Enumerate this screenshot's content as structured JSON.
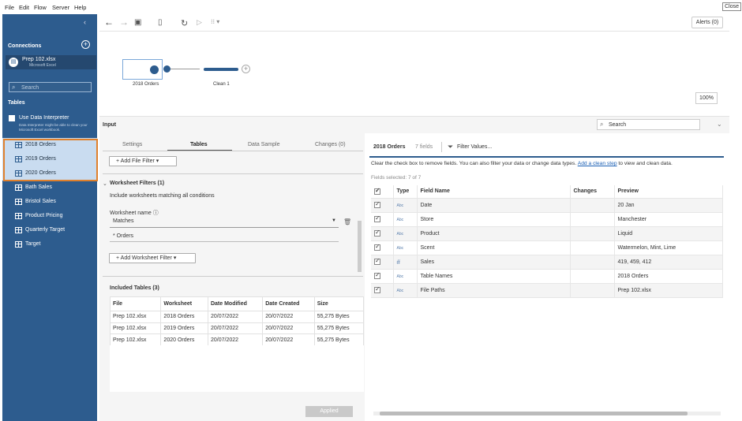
{
  "menu": [
    "File",
    "Edit",
    "Flow",
    "Server",
    "Help"
  ],
  "close_label": "Close",
  "toolbar": {
    "alerts": "Alerts (0)"
  },
  "sidebar": {
    "connections_title": "Connections",
    "connection": {
      "name": "Prep 102.xlsx",
      "type": "Microsoft Excel"
    },
    "search_placeholder": "Search",
    "tables_title": "Tables",
    "interpreter_label": "Use Data Interpreter",
    "interpreter_desc": "Data Interpreter might be able to clean your Microsoft Excel workbook.",
    "tables": [
      "2018 Orders",
      "2019 Orders",
      "2020 Orders",
      "Bath Sales",
      "Bristol Sales",
      "Product Pricing",
      "Quarterly Target",
      "Target"
    ]
  },
  "canvas": {
    "node1_label": "2018 Orders",
    "node2_label": "Clean 1",
    "zoom": "100%"
  },
  "input": {
    "title": "Input",
    "search_placeholder": "Search",
    "tabs": [
      "Settings",
      "Tables",
      "Data Sample",
      "Changes (0)"
    ],
    "add_file_filter": "+ Add File Filter ▾",
    "worksheet_filters_title": "Worksheet Filters (1)",
    "include_text": "Include worksheets matching all conditions",
    "worksheet_name_label": "Worksheet name ⓘ",
    "matches": "Matches",
    "pattern": "* Orders",
    "add_worksheet_filter": "+ Add Worksheet Filter ▾",
    "included_title": "Included Tables (3)",
    "included_headers": [
      "File",
      "Worksheet",
      "Date Modified",
      "Date Created",
      "Size"
    ],
    "included_rows": [
      [
        "Prep 102.xlsx",
        "2018 Orders",
        "20/07/2022",
        "20/07/2022",
        "55,275 Bytes"
      ],
      [
        "Prep 102.xlsx",
        "2019 Orders",
        "20/07/2022",
        "20/07/2022",
        "55,275 Bytes"
      ],
      [
        "Prep 102.xlsx",
        "2020 Orders",
        "20/07/2022",
        "20/07/2022",
        "55,275 Bytes"
      ]
    ],
    "applied": "Applied"
  },
  "fields": {
    "table_name": "2018 Orders",
    "count": "7 fields",
    "filter_values": "Filter Values...",
    "instructions_pre": "Clear the check box to remove fields. You can also filter your data or change data types.",
    "instructions_link": "Add a clean step",
    "instructions_post": "to view and clean data.",
    "selected": "Fields selected: 7 of 7",
    "headers": [
      "Type",
      "Field Name",
      "Changes",
      "Preview"
    ],
    "rows": [
      {
        "type": "Abc",
        "name": "Date",
        "changes": "",
        "preview": "20 Jan"
      },
      {
        "type": "Abc",
        "name": "Store",
        "changes": "",
        "preview": "Manchester"
      },
      {
        "type": "Abc",
        "name": "Product",
        "changes": "",
        "preview": "Liquid"
      },
      {
        "type": "Abc",
        "name": "Scent",
        "changes": "",
        "preview": "Watermelon, Mint, Lime"
      },
      {
        "type": "#",
        "name": "Sales",
        "changes": "",
        "preview": "419, 459, 412"
      },
      {
        "type": "Abc",
        "name": "Table Names",
        "changes": "",
        "preview": "2018 Orders"
      },
      {
        "type": "Abc",
        "name": "File Paths",
        "changes": "",
        "preview": "Prep 102.xlsx"
      }
    ]
  }
}
